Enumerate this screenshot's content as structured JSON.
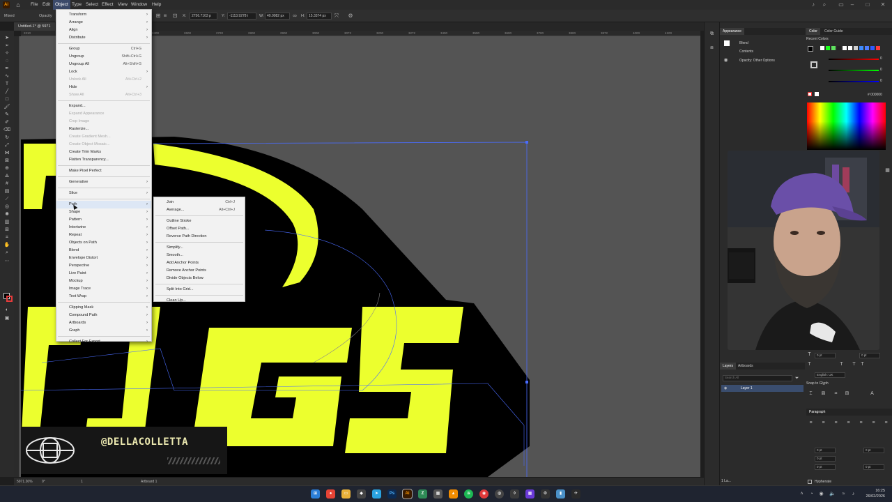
{
  "menubar": {
    "items": [
      "File",
      "Edit",
      "Object",
      "Type",
      "Select",
      "Effect",
      "View",
      "Window",
      "Help"
    ],
    "active": "Object"
  },
  "controlbar": {
    "opacity_label": "Opacity",
    "x": "2756.7103 p",
    "y": "-1113.9278 i",
    "w": "40.0082 px",
    "h": "15.3374 px"
  },
  "document": {
    "tab_label": "Untitled-1* @ 5971"
  },
  "ruler": {
    "top_ticks": [
      "2210",
      "2000",
      "2200",
      "2272",
      "2400",
      "2600",
      "2720",
      "2800",
      "2900",
      "3000",
      "3072",
      "3200",
      "3272",
      "3400",
      "3500",
      "3600",
      "3700",
      "3800",
      "3872",
      "4000",
      "4100"
    ]
  },
  "statusbar": {
    "zoom": "5971.26%",
    "rotation": "0°",
    "artboard_num": "1",
    "artboard_label": "Artboard 1"
  },
  "object_menu": {
    "items": [
      {
        "label": "Transform",
        "submenu": true
      },
      {
        "label": "Arrange",
        "submenu": true
      },
      {
        "label": "Align",
        "submenu": true
      },
      {
        "label": "Distribute",
        "submenu": true
      },
      {
        "sep": true
      },
      {
        "label": "Group",
        "shortcut": "Ctrl+G"
      },
      {
        "label": "Ungroup",
        "shortcut": "Shift+Ctrl+G"
      },
      {
        "label": "Ungroup All",
        "shortcut": "Alt+Shift+G"
      },
      {
        "label": "Lock",
        "submenu": true
      },
      {
        "label": "Unlock All",
        "shortcut": "Alt+Ctrl+2",
        "disabled": true
      },
      {
        "label": "Hide",
        "submenu": true
      },
      {
        "label": "Show All",
        "shortcut": "Alt+Ctrl+3",
        "disabled": true
      },
      {
        "sep": true
      },
      {
        "label": "Expand..."
      },
      {
        "label": "Expand Appearance",
        "disabled": true
      },
      {
        "label": "Crop Image",
        "disabled": true
      },
      {
        "label": "Rasterize..."
      },
      {
        "label": "Create Gradient Mesh...",
        "disabled": true
      },
      {
        "label": "Create Object Mosaic...",
        "disabled": true
      },
      {
        "label": "Create Trim Marks"
      },
      {
        "label": "Flatten Transparency..."
      },
      {
        "sep": true
      },
      {
        "label": "Make Pixel Perfect"
      },
      {
        "sep": true
      },
      {
        "label": "Generative",
        "submenu": true
      },
      {
        "sep": true
      },
      {
        "label": "Slice",
        "submenu": true
      },
      {
        "sep": true
      },
      {
        "label": "Path",
        "submenu": true,
        "highlight": true
      },
      {
        "label": "Shape",
        "submenu": true
      },
      {
        "label": "Pattern",
        "submenu": true
      },
      {
        "label": "Intertwine",
        "submenu": true
      },
      {
        "label": "Repeat",
        "submenu": true
      },
      {
        "label": "Objects on Path",
        "submenu": true
      },
      {
        "label": "Blend",
        "submenu": true
      },
      {
        "label": "Envelope Distort",
        "submenu": true
      },
      {
        "label": "Perspective",
        "submenu": true
      },
      {
        "label": "Live Paint",
        "submenu": true
      },
      {
        "label": "Mockup",
        "submenu": true
      },
      {
        "label": "Image Trace",
        "submenu": true
      },
      {
        "label": "Text Wrap",
        "submenu": true
      },
      {
        "sep": true
      },
      {
        "label": "Clipping Mask",
        "submenu": true
      },
      {
        "label": "Compound Path",
        "submenu": true
      },
      {
        "label": "Artboards",
        "submenu": true
      },
      {
        "label": "Graph",
        "submenu": true
      },
      {
        "sep": true
      },
      {
        "label": "Collect For Export",
        "submenu": true
      }
    ]
  },
  "path_submenu": {
    "items": [
      {
        "label": "Join",
        "shortcut": "Ctrl+J"
      },
      {
        "label": "Average...",
        "shortcut": "Alt+Ctrl+J"
      },
      {
        "sep": true
      },
      {
        "label": "Outline Stroke"
      },
      {
        "label": "Offset Path..."
      },
      {
        "label": "Reverse Path Direction"
      },
      {
        "sep": true
      },
      {
        "label": "Simplify..."
      },
      {
        "label": "Smooth..."
      },
      {
        "label": "Add Anchor Points"
      },
      {
        "label": "Remove Anchor Points"
      },
      {
        "label": "Divide Objects Below"
      },
      {
        "sep": true
      },
      {
        "label": "Split Into Grid..."
      },
      {
        "sep": true
      },
      {
        "label": "Clean Up..."
      }
    ]
  },
  "appearance_panel": {
    "tab": "Appearance",
    "blend_label": "Blend",
    "contents_label": "Contents",
    "opacity_label": "Opacity: Other Options"
  },
  "color_panel": {
    "tabs": [
      "Color",
      "Color Guide"
    ],
    "recent_label": "Recent Colors",
    "hex_value": "000000",
    "recent_colors": [
      "#ffffff",
      "#1aff1a",
      "#5fe35f",
      "#222222",
      "#ffffff",
      "#ffffff",
      "#cfcfcf",
      "#3d8bff",
      "#4d7dff",
      "#2e5cff",
      "#ff3a3a"
    ]
  },
  "character_panel": {
    "size_value": "0 pt",
    "language": "English: UK",
    "snap_label": "Snap to Glyph"
  },
  "layers_panel": {
    "tabs": [
      "Layers",
      "Artboards"
    ],
    "search_placeholder": "Search All",
    "layer_name": "Layer 1",
    "footer_label": "1 La..."
  },
  "paragraph_panel": {
    "title": "Paragraph",
    "indent_left": "0 pt",
    "indent_right": "0 pt",
    "indent_first": "0 pt",
    "space_before": "0 pt",
    "space_after": "0 pt",
    "hyphenate_label": "Hyphenate"
  },
  "artwork": {
    "text": "DMGS",
    "fill_color": "#ecff2e",
    "shape_color": "#000000",
    "canvas_color": "#545454"
  },
  "watermark": {
    "handle": "@DELLACOLLETTA"
  },
  "taskbar": {
    "time": "16:25",
    "date": "26/02/2026"
  },
  "icons": {
    "menubar": [
      "illustrator-logo-icon",
      "home-icon"
    ],
    "system": [
      "bell-icon",
      "search-icon",
      "workspace-icon",
      "minimize-icon",
      "maximize-icon",
      "close-icon"
    ]
  }
}
